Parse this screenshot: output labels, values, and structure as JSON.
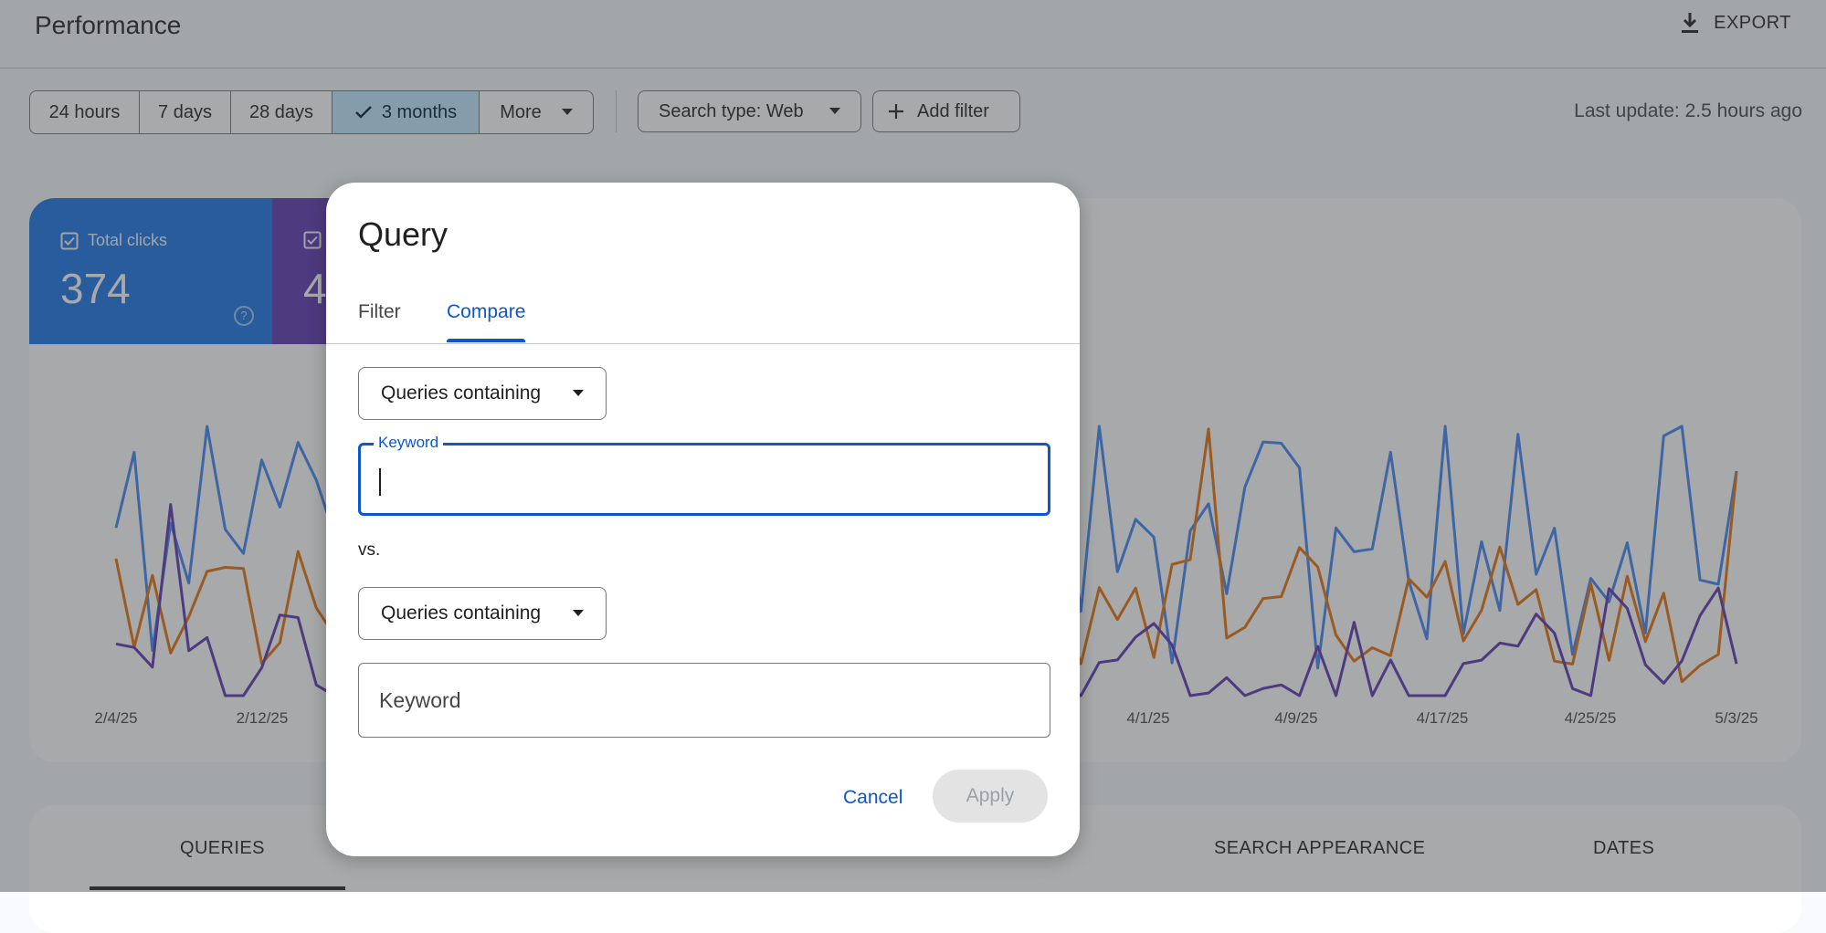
{
  "header": {
    "title": "Performance",
    "export_label": "EXPORT",
    "icons": {
      "export": "download-icon"
    }
  },
  "toolbar": {
    "date_ranges": [
      {
        "label": "24 hours",
        "selected": false
      },
      {
        "label": "7 days",
        "selected": false
      },
      {
        "label": "28 days",
        "selected": false
      },
      {
        "label": "3 months",
        "selected": true
      },
      {
        "label": "More",
        "selected": false
      }
    ],
    "search_type_label": "Search type: Web",
    "add_filter_label": "Add filter",
    "last_update": "Last update: 2.5 hours ago"
  },
  "metrics": [
    {
      "label": "Total clicks",
      "value": "374",
      "color": "#1a73e8"
    },
    {
      "label": "",
      "value": "4",
      "color": "#5e35b1"
    }
  ],
  "chart_data": {
    "type": "line",
    "x_tick_labels": [
      "2/4/25",
      "2/12/25",
      "4/1/25",
      "4/9/25",
      "4/17/25",
      "4/25/25",
      "5/3/25"
    ],
    "grid": false,
    "series": [
      {
        "color": "#4285f4",
        "values_visible": "normalized trace",
        "style": "line"
      },
      {
        "color": "#e8710a",
        "values_visible": "normalized trace",
        "style": "line"
      },
      {
        "color": "#5e35b1",
        "values_visible": "normalized trace",
        "style": "line"
      }
    ]
  },
  "bottom_tabs": [
    {
      "label": "QUERIES",
      "active": true
    },
    {
      "label": "SEARCH APPEARANCE",
      "active": false
    },
    {
      "label": "DATES",
      "active": false
    }
  ],
  "dialog": {
    "title": "Query",
    "tabs": [
      {
        "label": "Filter",
        "active": false
      },
      {
        "label": "Compare",
        "active": true
      }
    ],
    "first_select": "Queries containing",
    "first_keyword_label": "Keyword",
    "first_keyword_value": "",
    "vs_label": "vs.",
    "second_select": "Queries containing",
    "second_keyword_placeholder": "Keyword",
    "cancel_label": "Cancel",
    "apply_label": "Apply"
  },
  "colors": {
    "accent": "#0b57d0",
    "selected_chip": "#c2e7ff",
    "clicks": "#1a73e8",
    "impressions": "#5e35b1",
    "ctr": "#e8710a"
  }
}
